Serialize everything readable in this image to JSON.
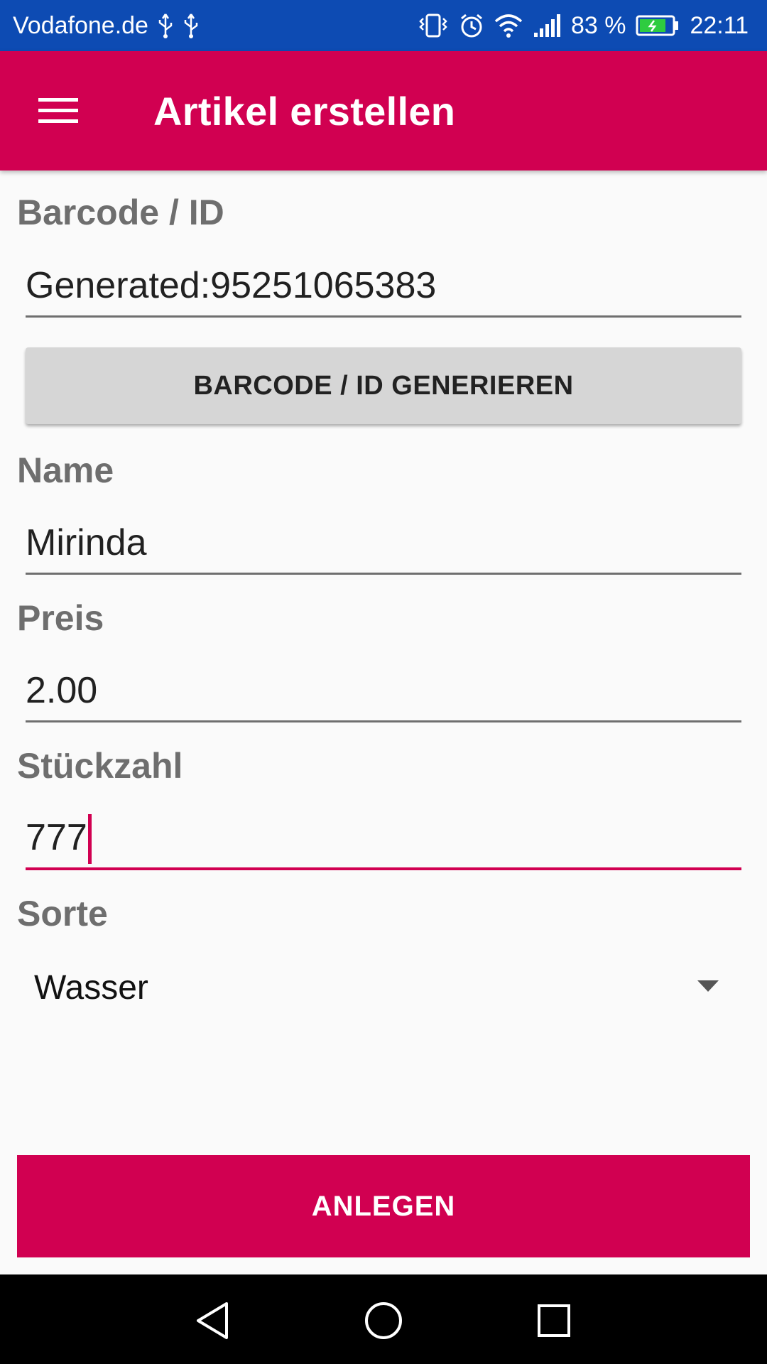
{
  "status_bar": {
    "carrier": "Vodafone.de",
    "battery_percent": "83 %",
    "battery_level": 0.83,
    "time": "22:11",
    "icons": [
      "usb-icon",
      "usb-icon",
      "vibrate-icon",
      "alarm-icon",
      "wifi-icon",
      "signal-icon",
      "battery-icon"
    ]
  },
  "app_bar": {
    "title": "Artikel erstellen",
    "menu_icon": "hamburger-menu-icon"
  },
  "form": {
    "barcode": {
      "label": "Barcode / ID",
      "value": "Generated:95251065383",
      "button_label": "BARCODE / ID GENERIEREN"
    },
    "name": {
      "label": "Name",
      "value": "Mirinda"
    },
    "price": {
      "label": "Preis",
      "value": "2.00"
    },
    "quantity": {
      "label": "Stückzahl",
      "value": "777"
    },
    "type": {
      "label": "Sorte",
      "selected": "Wasser",
      "icon": "dropdown-arrow-icon"
    },
    "submit_label": "ANLEGEN"
  },
  "nav_bar": {
    "icons": [
      "back-icon",
      "home-icon",
      "recents-icon"
    ]
  },
  "colors": {
    "status_bar": "#0d4bb3",
    "accent": "#d10051",
    "background": "#fafafa",
    "label": "#6e6e6e",
    "button_grey": "#d6d6d6"
  }
}
